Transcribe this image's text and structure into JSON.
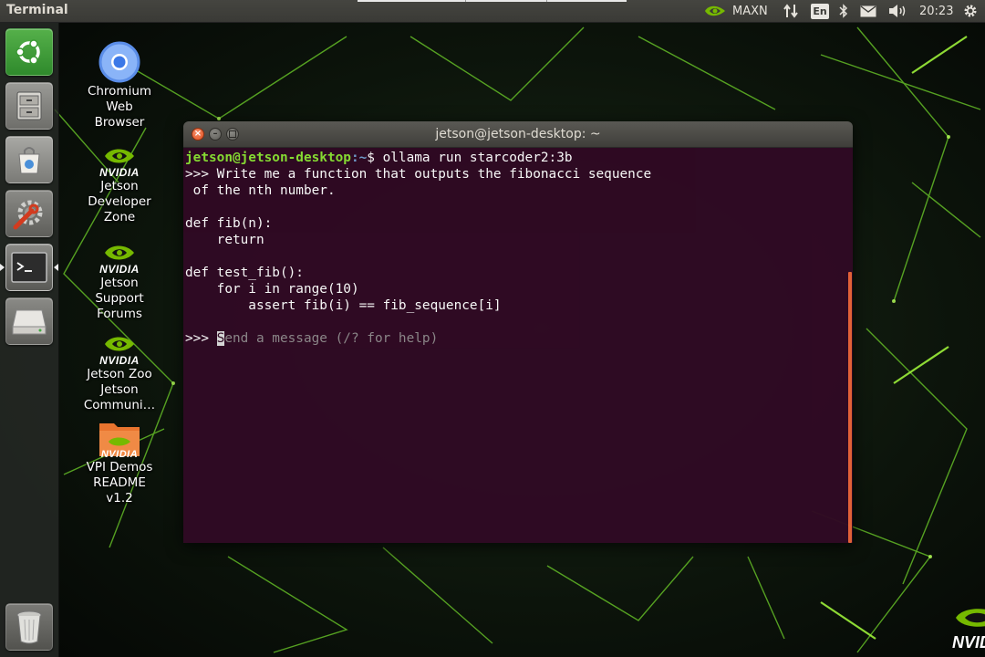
{
  "top_panel": {
    "app_title": "Terminal",
    "power_mode": "MAXN",
    "keyboard_layout": "En",
    "clock": "20:23",
    "icons": [
      "nvidia-icon",
      "network-arrows-icon",
      "keyboard-icon",
      "bluetooth-icon",
      "mail-icon",
      "volume-icon",
      "gear-icon"
    ]
  },
  "launcher": {
    "items": [
      {
        "name": "ubuntu-dash",
        "icon": "ubuntu-logo-icon"
      },
      {
        "name": "files",
        "icon": "file-cabinet-icon"
      },
      {
        "name": "software-center",
        "icon": "shopping-bag-icon"
      },
      {
        "name": "system-settings",
        "icon": "wrench-gear-icon"
      },
      {
        "name": "terminal",
        "icon": "terminal-icon"
      },
      {
        "name": "drive",
        "icon": "drive-icon"
      },
      {
        "name": "trash",
        "icon": "trash-icon"
      }
    ]
  },
  "desktop": {
    "icons": [
      {
        "label_lines": [
          "Chromium",
          "Web",
          "Browser"
        ],
        "icon": "chromium-icon"
      },
      {
        "label_lines": [
          "Jetson",
          "Developer",
          "Zone"
        ],
        "icon": "nvidia-logo-icon",
        "logo_text": "NVIDIA"
      },
      {
        "label_lines": [
          "Jetson",
          "Support",
          "Forums"
        ],
        "icon": "nvidia-logo-icon",
        "logo_text": "NVIDIA"
      },
      {
        "label_lines": [
          "Jetson Zoo",
          "Jetson",
          "Communi…"
        ],
        "icon": "nvidia-logo-icon",
        "logo_text": "NVIDIA"
      },
      {
        "label_lines": [
          "VPI Demos",
          "README",
          "v1.2"
        ],
        "icon": "folder-icon",
        "logo_text": "NVIDIA"
      }
    ],
    "corner_logo_text": "NVID"
  },
  "terminal": {
    "window_title": "jetson@jetson-desktop: ~",
    "prompt_user": "jetson@jetson-desktop",
    "prompt_path": ":~",
    "prompt_symbol": "$ ",
    "command": "ollama run starcoder2:3b",
    "output_lines": [
      ">>> Write me a function that outputs the fibonacci sequence",
      " of the nth number.",
      "",
      "def fib(n):",
      "    return",
      "",
      "def test_fib():",
      "    for i in range(10)",
      "        assert fib(i) == fib_sequence[i]",
      ""
    ],
    "input_prompt": ">>> ",
    "input_placeholder_first": "S",
    "input_placeholder_rest": "end a message (/? for help)",
    "accent_color": "#e8643a",
    "background_color": "#300a24"
  }
}
